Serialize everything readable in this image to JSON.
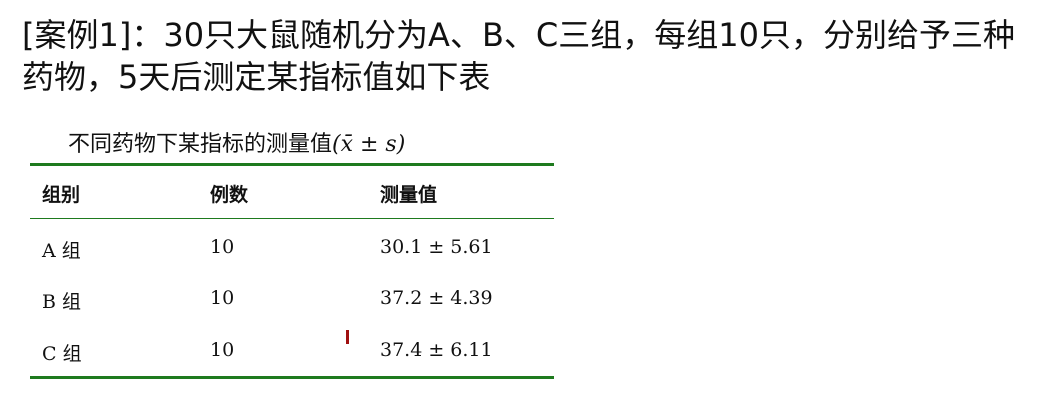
{
  "case": {
    "heading": "[案例1]：30只大鼠随机分为A、B、C三组，每组10只，分别给予三种药物，5天后测定某指标值如下表"
  },
  "table": {
    "caption_main": "不同药物下某指标的测量值",
    "caption_stat": "(x̄ ± s)",
    "headers": {
      "group": "组别",
      "count": "例数",
      "value": "测量值"
    },
    "rows": [
      {
        "group": "A 组",
        "count": "10",
        "value": "30.1 ± 5.61"
      },
      {
        "group": "B 组",
        "count": "10",
        "value": "37.2 ± 4.39"
      },
      {
        "group": "C 组",
        "count": "10",
        "value": "37.4 ± 6.11"
      }
    ]
  },
  "colors": {
    "rule": "#1e7a1e",
    "cursor": "#a01010"
  }
}
